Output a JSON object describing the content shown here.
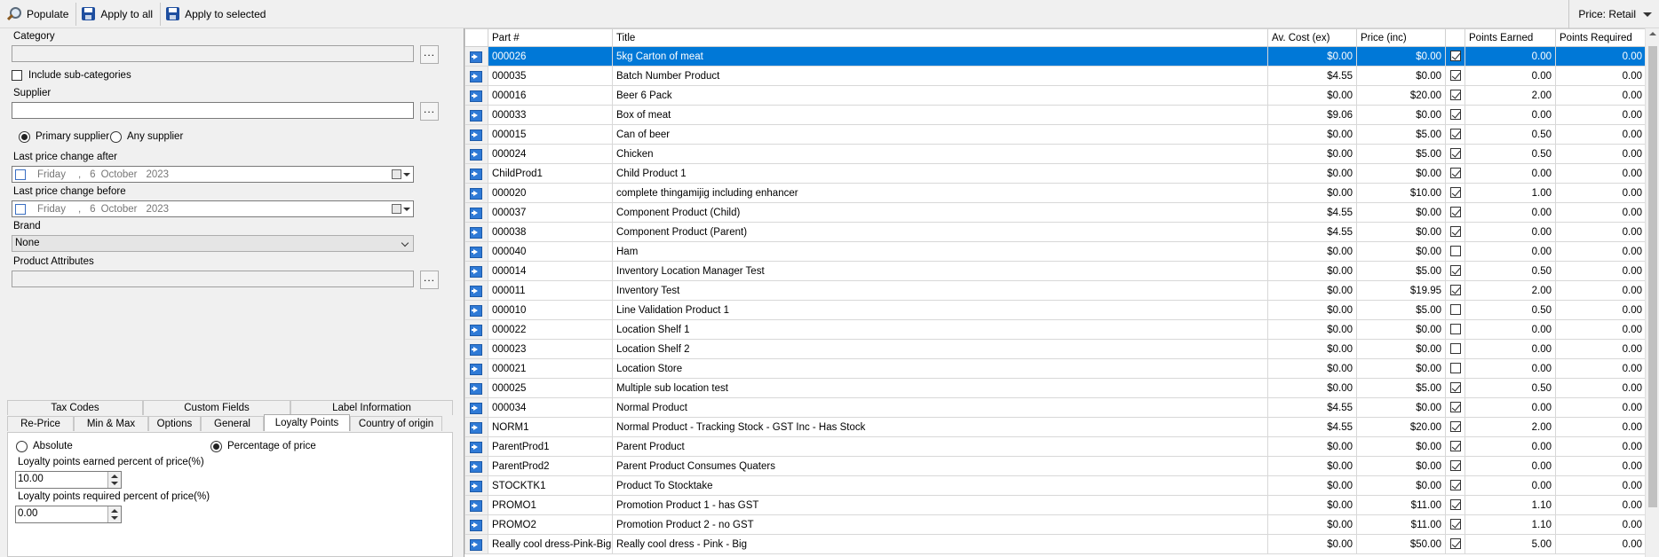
{
  "toolbar": {
    "populate": "Populate",
    "apply_all": "Apply to all",
    "apply_selected": "Apply to selected",
    "price_mode": "Price: Retail"
  },
  "filters": {
    "category_label": "Category",
    "category_value": "",
    "include_sub": "Include sub-categories",
    "include_sub_checked": false,
    "supplier_label": "Supplier",
    "supplier_value": "",
    "primary_supplier": "Primary supplier",
    "any_supplier": "Any supplier",
    "supplier_mode": "primary",
    "after_label": "Last price change after",
    "before_label": "Last price change before",
    "date": {
      "day": "Friday",
      "sep": ",",
      "num": "6",
      "month": "October",
      "year": "2023"
    },
    "brand_label": "Brand",
    "brand_value": "None",
    "attributes_label": "Product Attributes",
    "attributes_value": "",
    "browse": "..."
  },
  "tabs": {
    "row1": [
      "Tax Codes",
      "Custom Fields",
      "Label Information"
    ],
    "row2": [
      "Re-Price",
      "Min & Max",
      "Options",
      "General",
      "Loyalty Points",
      "Country of origin"
    ],
    "active": "Loyalty Points"
  },
  "loyalty": {
    "absolute": "Absolute",
    "percentage": "Percentage of price",
    "mode": "percentage",
    "earned_label": "Loyalty points earned percent of price(%)",
    "earned_value": "10.00",
    "required_label": "Loyalty points required percent of price(%)",
    "required_value": "0.00"
  },
  "grid": {
    "columns": [
      "Part #",
      "Title",
      "Av. Cost (ex)",
      "Price (inc)",
      "",
      "Points Earned",
      "Points Required"
    ],
    "rows": [
      {
        "part": "000026",
        "title": "5kg Carton of meat",
        "cost": "$0.00",
        "price": "$0.00",
        "chk": true,
        "earned": "0.00",
        "required": "0.00",
        "selected": true
      },
      {
        "part": "000035",
        "title": "Batch Number Product",
        "cost": "$4.55",
        "price": "$0.00",
        "chk": true,
        "earned": "0.00",
        "required": "0.00"
      },
      {
        "part": "000016",
        "title": "Beer 6 Pack",
        "cost": "$0.00",
        "price": "$20.00",
        "chk": true,
        "earned": "2.00",
        "required": "0.00"
      },
      {
        "part": "000033",
        "title": "Box of meat",
        "cost": "$9.06",
        "price": "$0.00",
        "chk": true,
        "earned": "0.00",
        "required": "0.00"
      },
      {
        "part": "000015",
        "title": "Can of beer",
        "cost": "$0.00",
        "price": "$5.00",
        "chk": true,
        "earned": "0.50",
        "required": "0.00"
      },
      {
        "part": "000024",
        "title": "Chicken",
        "cost": "$0.00",
        "price": "$5.00",
        "chk": true,
        "earned": "0.50",
        "required": "0.00"
      },
      {
        "part": "ChildProd1",
        "title": "Child Product 1",
        "cost": "$0.00",
        "price": "$0.00",
        "chk": true,
        "earned": "0.00",
        "required": "0.00"
      },
      {
        "part": "000020",
        "title": "complete thingamijig including enhancer",
        "cost": "$0.00",
        "price": "$10.00",
        "chk": true,
        "earned": "1.00",
        "required": "0.00"
      },
      {
        "part": "000037",
        "title": "Component Product (Child)",
        "cost": "$4.55",
        "price": "$0.00",
        "chk": true,
        "earned": "0.00",
        "required": "0.00"
      },
      {
        "part": "000038",
        "title": "Component Product (Parent)",
        "cost": "$4.55",
        "price": "$0.00",
        "chk": true,
        "earned": "0.00",
        "required": "0.00"
      },
      {
        "part": "000040",
        "title": "Ham",
        "cost": "$0.00",
        "price": "$0.00",
        "chk": false,
        "earned": "0.00",
        "required": "0.00"
      },
      {
        "part": "000014",
        "title": "Inventory Location Manager Test",
        "cost": "$0.00",
        "price": "$5.00",
        "chk": true,
        "earned": "0.50",
        "required": "0.00"
      },
      {
        "part": "000011",
        "title": "Inventory Test",
        "cost": "$0.00",
        "price": "$19.95",
        "chk": true,
        "earned": "2.00",
        "required": "0.00"
      },
      {
        "part": "000010",
        "title": "Line Validation Product 1",
        "cost": "$0.00",
        "price": "$5.00",
        "chk": false,
        "earned": "0.50",
        "required": "0.00"
      },
      {
        "part": "000022",
        "title": "Location Shelf 1",
        "cost": "$0.00",
        "price": "$0.00",
        "chk": false,
        "earned": "0.00",
        "required": "0.00"
      },
      {
        "part": "000023",
        "title": "Location Shelf 2",
        "cost": "$0.00",
        "price": "$0.00",
        "chk": false,
        "earned": "0.00",
        "required": "0.00"
      },
      {
        "part": "000021",
        "title": "Location Store",
        "cost": "$0.00",
        "price": "$0.00",
        "chk": false,
        "earned": "0.00",
        "required": "0.00"
      },
      {
        "part": "000025",
        "title": "Multiple sub location test",
        "cost": "$0.00",
        "price": "$5.00",
        "chk": true,
        "earned": "0.50",
        "required": "0.00"
      },
      {
        "part": "000034",
        "title": "Normal Product",
        "cost": "$4.55",
        "price": "$0.00",
        "chk": true,
        "earned": "0.00",
        "required": "0.00"
      },
      {
        "part": "NORM1",
        "title": "Normal Product - Tracking Stock - GST Inc - Has Stock",
        "cost": "$4.55",
        "price": "$20.00",
        "chk": true,
        "earned": "2.00",
        "required": "0.00"
      },
      {
        "part": "ParentProd1",
        "title": "Parent Product",
        "cost": "$0.00",
        "price": "$0.00",
        "chk": true,
        "earned": "0.00",
        "required": "0.00"
      },
      {
        "part": "ParentProd2",
        "title": "Parent Product Consumes Quaters",
        "cost": "$0.00",
        "price": "$0.00",
        "chk": true,
        "earned": "0.00",
        "required": "0.00"
      },
      {
        "part": "STOCKTK1",
        "title": "Product To Stocktake",
        "cost": "$0.00",
        "price": "$0.00",
        "chk": true,
        "earned": "0.00",
        "required": "0.00"
      },
      {
        "part": "PROMO1",
        "title": "Promotion Product 1 - has GST",
        "cost": "$0.00",
        "price": "$11.00",
        "chk": true,
        "earned": "1.10",
        "required": "0.00"
      },
      {
        "part": "PROMO2",
        "title": "Promotion Product 2 - no GST",
        "cost": "$0.00",
        "price": "$11.00",
        "chk": true,
        "earned": "1.10",
        "required": "0.00"
      },
      {
        "part": "Really cool dress-Pink-Big",
        "title": "Really cool dress - Pink - Big",
        "cost": "$0.00",
        "price": "$50.00",
        "chk": true,
        "earned": "5.00",
        "required": "0.00"
      }
    ]
  }
}
